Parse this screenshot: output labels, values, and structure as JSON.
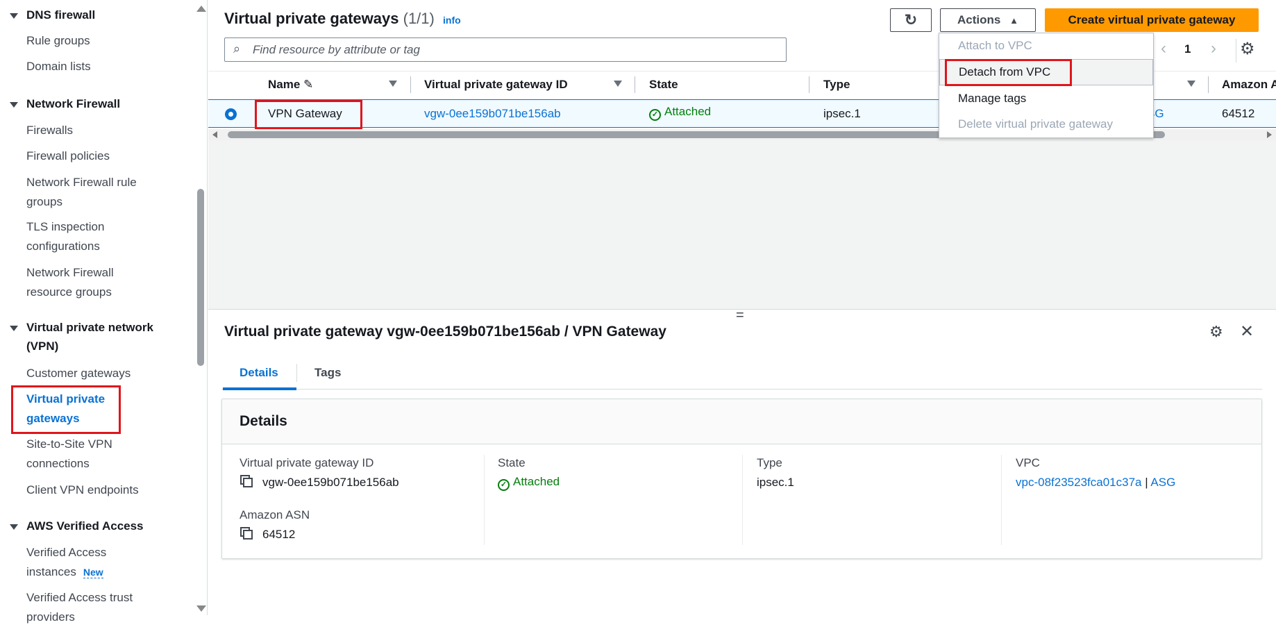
{
  "sidebar": {
    "sections": [
      {
        "label": "DNS firewall",
        "items": [
          "Rule groups",
          "Domain lists"
        ]
      },
      {
        "label": "Network Firewall",
        "items": [
          "Firewalls",
          "Firewall policies",
          "Network Firewall rule groups",
          "TLS inspection configurations",
          "Network Firewall resource groups"
        ]
      },
      {
        "label": "Virtual private network (VPN)",
        "items": [
          "Customer gateways",
          "Virtual private gateways",
          "Site-to-Site VPN connections",
          "Client VPN endpoints"
        ]
      },
      {
        "label": "AWS Verified Access",
        "items": [
          "Verified Access instances",
          "Verified Access trust providers"
        ]
      }
    ],
    "new_badge": "New"
  },
  "header": {
    "title": "Virtual private gateways",
    "count": "(1/1)",
    "info": "info",
    "actions": "Actions",
    "create": "Create virtual private gateway",
    "search_placeholder": "Find resource by attribute or tag",
    "page": "1"
  },
  "actions_menu": [
    {
      "label": "Attach to VPC",
      "disabled": true
    },
    {
      "label": "Detach from VPC",
      "disabled": false,
      "highlighted": true
    },
    {
      "label": "Manage tags",
      "disabled": false
    },
    {
      "label": "Delete virtual private gateway",
      "disabled": true
    }
  ],
  "table": {
    "columns": [
      "Name",
      "Virtual private gateway ID",
      "State",
      "Type",
      "Amazon A"
    ],
    "row": {
      "name": "VPN Gateway",
      "id": "vgw-0ee159b071be156ab",
      "state": "Attached",
      "type": "ipsec.1",
      "vpc_partial": "SG",
      "asn": "64512"
    }
  },
  "detail": {
    "title": "Virtual private gateway vgw-0ee159b071be156ab / VPN Gateway",
    "tabs": [
      "Details",
      "Tags"
    ],
    "panel_title": "Details",
    "fields": {
      "id_label": "Virtual private gateway ID",
      "id": "vgw-0ee159b071be156ab",
      "state_label": "State",
      "state": "Attached",
      "type_label": "Type",
      "type": "ipsec.1",
      "vpc_label": "VPC",
      "vpc": "vpc-08f23523fca01c37a",
      "vpc_sep": " | ",
      "vpc_name": "ASG",
      "asn_label": "Amazon ASN",
      "asn": "64512"
    }
  },
  "colors": {
    "accent": "#0972d3",
    "primary": "#ff9900",
    "success": "#037f0c",
    "highlight": "#e0151b"
  }
}
